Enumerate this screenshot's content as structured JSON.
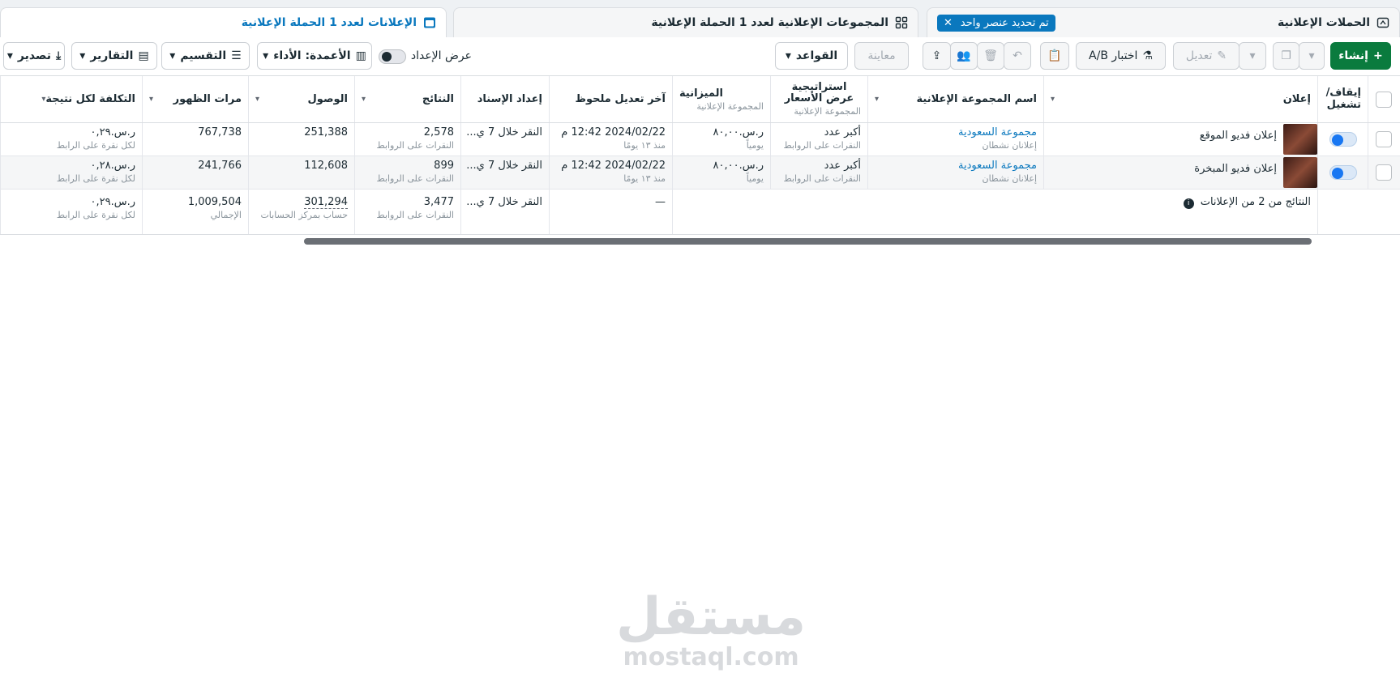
{
  "tabs": {
    "campaigns": "الحملات الإعلانية",
    "chip": "تم تحديد عنصر واحد",
    "adsets": "المجموعات الإعلانية لعدد 1 الحملة الإعلانية",
    "ads": "الإعلانات لعدد 1 الحملة الإعلانية"
  },
  "toolbar": {
    "create": "إنشاء",
    "edit": "تعديل",
    "ab_test": "اختبار A/B",
    "preview": "معاينة",
    "rules": "القواعد",
    "show_setup": "عرض الإعداد",
    "columns": "الأعمدة: الأداء",
    "breakdown": "التقسيم",
    "reports": "التقارير",
    "export": "تصدير"
  },
  "headers": {
    "toggle": "إيقاف/ تشغيل",
    "ad": "إعلان",
    "adset_name": "اسم المجموعة الإعلانية",
    "bid_strategy": "استراتيجية عرض الأسعار",
    "bid_strategy_sub": "المجموعة الإعلانية",
    "budget": "الميزانية",
    "budget_sub": "المجموعة الإعلانية",
    "last_edit": "آخر تعديل ملحوظ",
    "attribution": "إعداد الإسناد",
    "results": "النتائج",
    "reach": "الوصول",
    "impressions": "مرات الظهور",
    "cost_per_result": "التكلفة لكل نتيجة"
  },
  "rows": [
    {
      "ad": "إعلان فديو الموقع",
      "adset": "مجموعة السعودية",
      "adset_sub": "إعلانان نشطان",
      "bid": "أكبر عدد",
      "bid_sub": "النقرات على الروابط",
      "budget": "ر.س.٨٠,٠٠",
      "budget_sub": "يومياً",
      "last_edit": "2024/02/22 12:42 م",
      "last_edit_sub": "منذ ١٣ يومًا",
      "attribution": "النقر خلال 7 ي...",
      "results": "2,578",
      "results_sub": "النقرات على الروابط",
      "reach": "251,388",
      "impressions": "767,738",
      "cost": "ر.س.٠,٢٩",
      "cost_sub": "لكل نقرة على الرابط"
    },
    {
      "ad": "إعلان فديو المبخرة",
      "adset": "مجموعة السعودية",
      "adset_sub": "إعلانان نشطان",
      "bid": "أكبر عدد",
      "bid_sub": "النقرات على الروابط",
      "budget": "ر.س.٨٠,٠٠",
      "budget_sub": "يومياً",
      "last_edit": "2024/02/22 12:42 م",
      "last_edit_sub": "منذ ١٣ يومًا",
      "attribution": "النقر خلال 7 ي...",
      "results": "899",
      "results_sub": "النقرات على الروابط",
      "reach": "112,608",
      "impressions": "241,766",
      "cost": "ر.س.٠,٢٨",
      "cost_sub": "لكل نقرة على الرابط"
    }
  ],
  "summary": {
    "label": "النتائج من 2 من الإعلانات",
    "last_edit": "—",
    "attribution": "النقر خلال 7 ي...",
    "results": "3,477",
    "results_sub": "النقرات على الروابط",
    "reach": "301,294",
    "reach_sub": "حساب بمركز الحسابات",
    "impressions": "1,009,504",
    "impressions_sub": "الإجمالي",
    "cost": "ر.س.٠,٢٩",
    "cost_sub": "لكل نقرة على الرابط"
  },
  "watermark": {
    "arabic": "مستقل",
    "latin": "mostaql.com"
  }
}
